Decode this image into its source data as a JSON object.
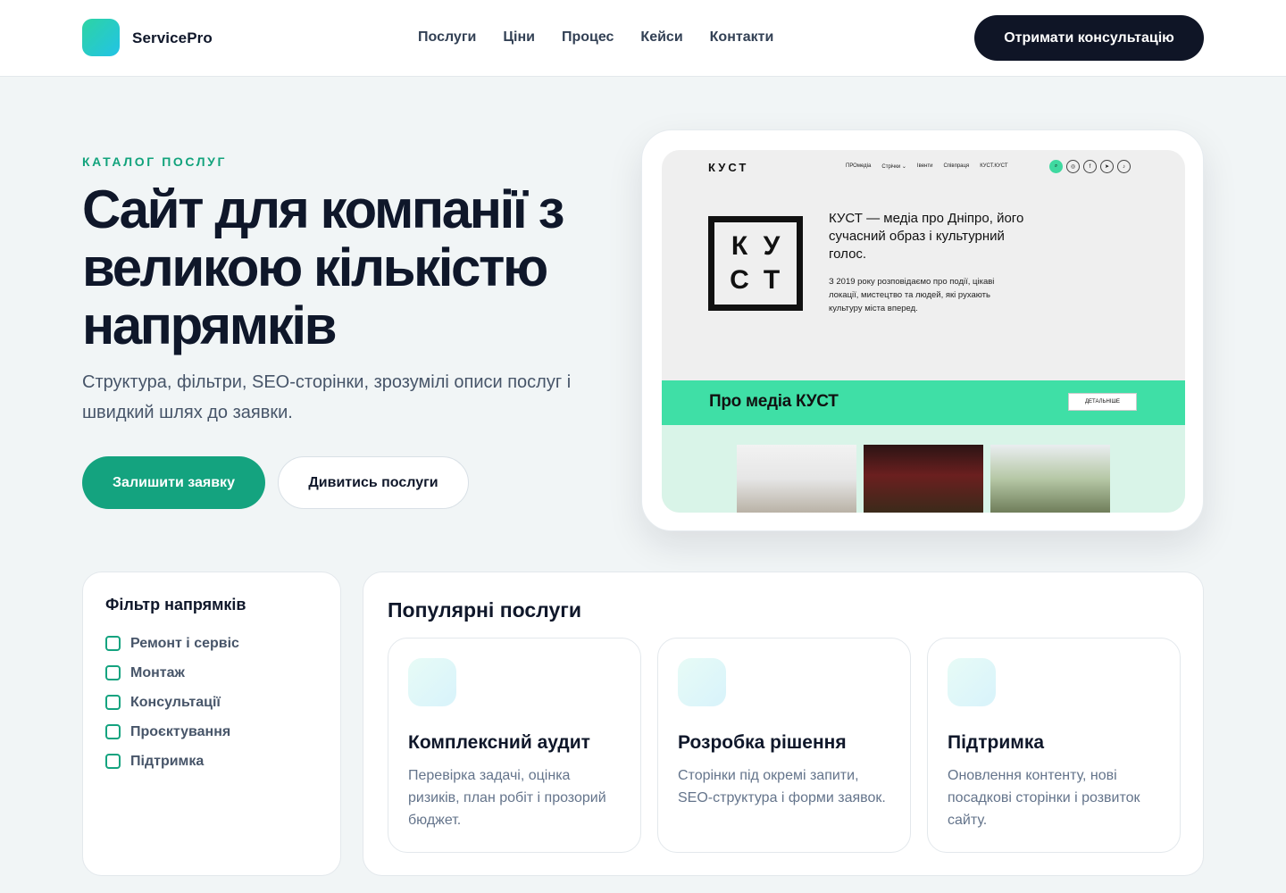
{
  "brand": {
    "name": "ServicePro"
  },
  "nav": [
    "Послуги",
    "Ціни",
    "Процес",
    "Кейси",
    "Контакти"
  ],
  "header_cta": "Отримати консультацію",
  "hero": {
    "eyebrow": "КАТАЛОГ ПОСЛУГ",
    "title": "Сайт для компанії з великою кількістю напрямків",
    "subtitle": "Структура, фільтри, SEO-сторінки, зрозумілі описи послуг і швидкий шлях до заявки.",
    "primary_button": "Залишити заявку",
    "secondary_button": "Дивитись послуги"
  },
  "preview": {
    "logo": "КУСТ",
    "nav": [
      "ПРОмедіа",
      "Стрічки ⌄",
      "Івенти",
      "Співпраця",
      "КУСТ.КУСТ"
    ],
    "box_letters": [
      "К",
      "У",
      "С",
      "Т"
    ],
    "headline": "КУСТ — медіа про Дніпро, його сучасний образ і культурний голос.",
    "paragraph": "З 2019 року розповідаємо про події, цікаві локації, мистецтво та людей, які рухають культуру міста вперед.",
    "band_title": "Про медіа КУСТ",
    "band_button": "ДЕТАЛЬНІШЕ"
  },
  "filter": {
    "title": "Фільтр напрямків",
    "items": [
      "Ремонт і сервіс",
      "Монтаж",
      "Консультації",
      "Проєктування",
      "Підтримка"
    ]
  },
  "services": {
    "title": "Популярні послуги",
    "cards": [
      {
        "title": "Комплексний аудит",
        "desc": "Перевірка задачі, оцінка ризиків, план робіт і прозорий бюджет."
      },
      {
        "title": "Розробка рішення",
        "desc": "Сторінки під окремі запити, SEO-структура і форми заявок."
      },
      {
        "title": "Підтримка",
        "desc": "Оновлення контенту, нові посадкові сторінки і розвиток сайту."
      }
    ]
  },
  "colors": {
    "accent": "#14a37f",
    "dark": "#0f1526",
    "band": "#3fdfa6"
  }
}
